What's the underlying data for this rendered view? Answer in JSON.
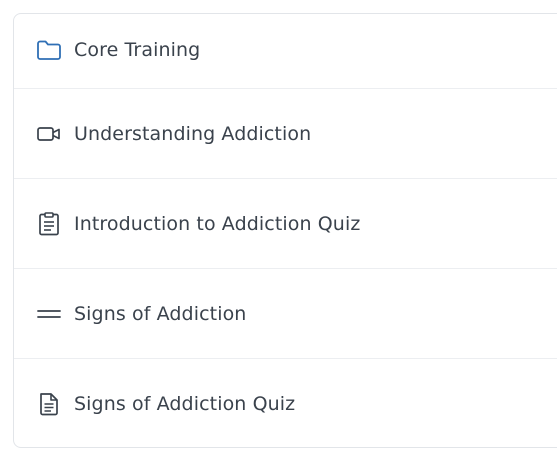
{
  "section": {
    "title": "Core Training",
    "icon": "folder-icon",
    "icon_color": "#2f6fb5"
  },
  "items": [
    {
      "label": "Understanding Addiction",
      "icon": "video-icon"
    },
    {
      "label": "Introduction to Addiction Quiz",
      "icon": "clipboard-icon"
    },
    {
      "label": "Signs of Addiction",
      "icon": "text-lines-icon"
    },
    {
      "label": "Signs of Addiction Quiz",
      "icon": "document-icon"
    }
  ],
  "colors": {
    "text": "#3a424c",
    "border": "#e2e5e9",
    "icon": "#3a424c"
  }
}
